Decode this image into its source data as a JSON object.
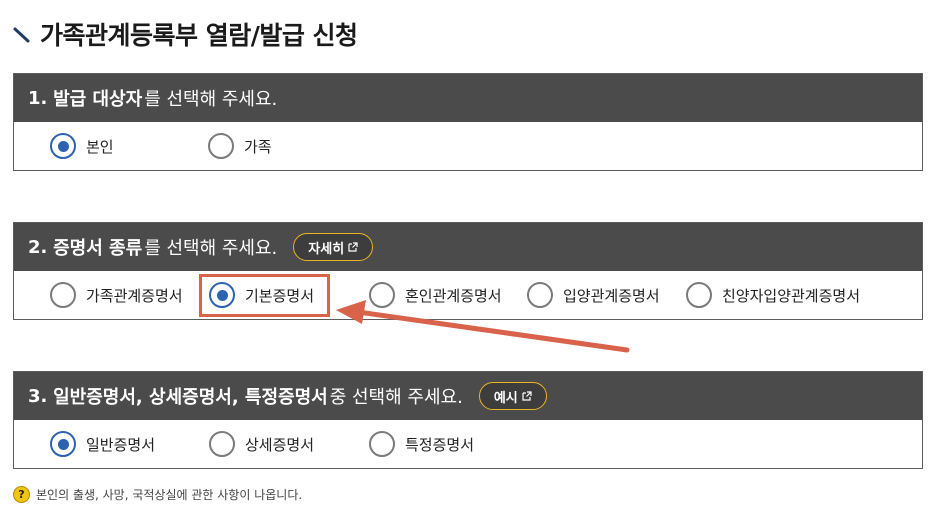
{
  "page": {
    "title": "가족관계등록부 열람/발급 신청"
  },
  "section1": {
    "number": "1.",
    "bold": "발급 대상자",
    "rest": "를 선택해 주세요.",
    "options": [
      {
        "label": "본인",
        "checked": true
      },
      {
        "label": "가족",
        "checked": false
      }
    ]
  },
  "section2": {
    "number": "2.",
    "bold": "증명서 종류",
    "rest": "를 선택해 주세요.",
    "detail_button": "자세히",
    "options": [
      {
        "label": "가족관계증명서",
        "checked": false
      },
      {
        "label": "기본증명서",
        "checked": true
      },
      {
        "label": "혼인관계증명서",
        "checked": false
      },
      {
        "label": "입양관계증명서",
        "checked": false
      },
      {
        "label": "친양자입양관계증명서",
        "checked": false
      }
    ]
  },
  "section3": {
    "number": "3.",
    "bold": "일반증명서, 상세증명서, 특정증명서",
    "rest": " 중 선택해 주세요.",
    "example_button": "예시",
    "options": [
      {
        "label": "일반증명서",
        "checked": true
      },
      {
        "label": "상세증명서",
        "checked": false
      },
      {
        "label": "특정증명서",
        "checked": false
      }
    ]
  },
  "note": {
    "icon": "?",
    "text": "본인의 출생, 사망, 국적상실에 관한 사항이 나옵니다."
  },
  "colors": {
    "header_bg": "#4b4b4b",
    "radio_checked": "#2d62b0",
    "pill_border": "#e9b526",
    "annotation": "#d9634a"
  }
}
